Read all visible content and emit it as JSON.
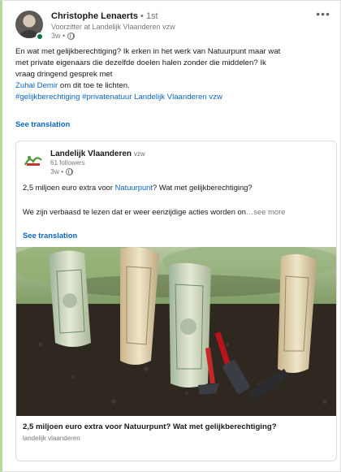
{
  "author": {
    "name": "Christophe Lenaerts",
    "degree": "• 1st",
    "headline": "Voorzitter at Landelijk Vlaanderen vzw",
    "time": "3w •"
  },
  "post": {
    "line1": "En wat met gelijkberechtiging? Ik erken in het werk van Natuurpunt maar wat",
    "line2": "met private eigenaars die dezelfde doelen halen zonder die middelen? Ik",
    "line3": "vraag dringend gesprek met",
    "mention": "Zuhal Demir",
    "line4_rest": " om dit toe te lichten.",
    "hashtags": "#gelijkberechtiging #privatenatuur Landelijk Vlaanderen vzw",
    "see_translation": "See translation"
  },
  "shared": {
    "org_name": "Landelijk Vlaanderen",
    "org_suffix": "vzw",
    "followers": "61 followers",
    "time": "3w •",
    "text1_pre": "2,5 miljoen euro extra voor ",
    "text1_link": "Natuurpunt",
    "text1_post": "? Wat met gelijkberechtiging?",
    "text2": "We zijn verbaasd te lezen dat er weer eenzijdige acties worden on",
    "see_more": "…see more",
    "see_translation": "See translation",
    "article_title": "2,5 miljoen euro extra voor Natuurpunt? Wat met gelijkberechtiging?",
    "article_source": "landelijk vlaanderen"
  },
  "icons": {
    "more": "more-icon",
    "globe": "globe-icon"
  },
  "colors": {
    "link": "#0a66c2",
    "online": "#057642"
  }
}
